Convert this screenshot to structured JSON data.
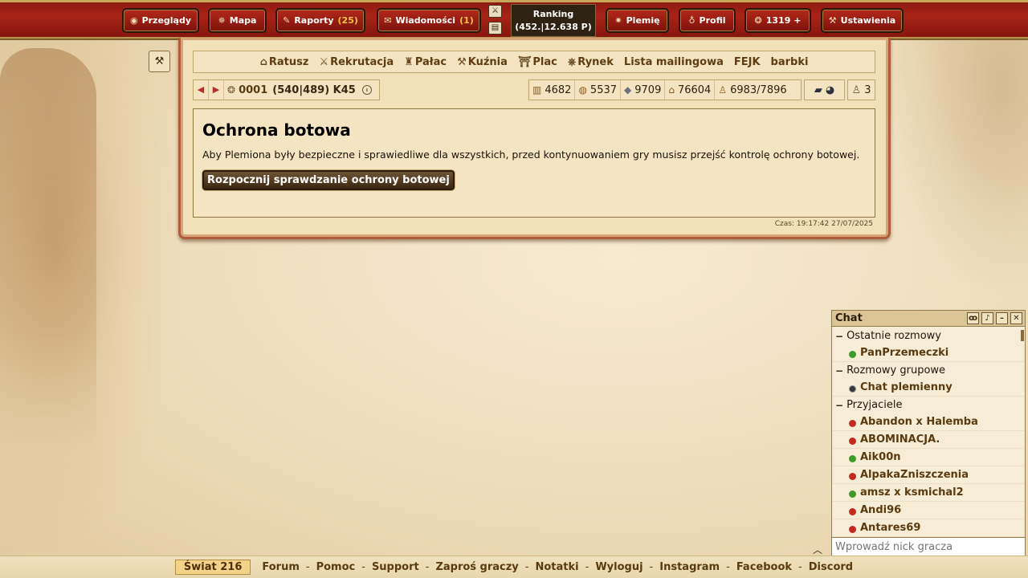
{
  "topbar": {
    "buttons": [
      {
        "label": "Przeglądy",
        "icon": "eye-icon"
      },
      {
        "label": "Mapa",
        "icon": "compass-icon"
      },
      {
        "label": "Raporty",
        "count": "(25)",
        "icon": "quill-icon"
      },
      {
        "label": "Wiadomości",
        "count": "(1)",
        "icon": "envelope-icon"
      },
      {
        "label": "Plemię",
        "icon": "tribe-icon"
      },
      {
        "label": "Profil",
        "icon": "potion-icon"
      },
      {
        "label": "1319 +",
        "icon": "premium-coin-icon"
      },
      {
        "label": "Ustawienia",
        "icon": "settings-icon"
      }
    ],
    "ranking_title": "Ranking",
    "ranking_value": "(452.|12.638 P)"
  },
  "menu": {
    "items": [
      {
        "label": "Ratusz",
        "icon": "town-hall-icon"
      },
      {
        "label": "Rekrutacja",
        "icon": "swords-icon"
      },
      {
        "label": "Pałac",
        "icon": "palace-icon"
      },
      {
        "label": "Kuźnia",
        "icon": "anvil-icon"
      },
      {
        "label": "Plac",
        "icon": "rally-point-icon"
      },
      {
        "label": "Rynek",
        "icon": "market-wheel-icon"
      },
      {
        "label": "Lista mailingowa"
      },
      {
        "label": "FEJK"
      },
      {
        "label": "barbki"
      }
    ]
  },
  "village": {
    "name": "0001",
    "coords": "(540|489) K45"
  },
  "resources": {
    "wood": "4682",
    "clay": "5537",
    "iron": "9709",
    "storage": "76604",
    "population": "6983/7896",
    "units": "3"
  },
  "content": {
    "title": "Ochrona botowa",
    "description": "Aby Plemiona były bezpieczne i sprawiedliwe dla wszystkich, przed kontynuowaniem gry musisz przejść kontrolę ochrony botowej.",
    "button": "Rozpocznij sprawdzanie ochrony botowej",
    "server_time": "Czas: 19:17:42 27/07/2025"
  },
  "chat": {
    "title": "Chat",
    "input_placeholder": "Wprowadź nick gracza",
    "groups": [
      {
        "label": "Ostatnie rozmowy",
        "items": [
          {
            "name": "PanPrzemeczki",
            "status": "online"
          }
        ]
      },
      {
        "label": "Rozmowy grupowe",
        "items": [
          {
            "name": "Chat plemienny",
            "status": "group"
          }
        ]
      },
      {
        "label": "Przyjaciele",
        "items": [
          {
            "name": "Abandon x Halemba",
            "status": "offline"
          },
          {
            "name": "ABOMINACJA.",
            "status": "offline"
          },
          {
            "name": "Aik00n",
            "status": "online"
          },
          {
            "name": "AlpakaZniszczenia",
            "status": "offline"
          },
          {
            "name": "amsz x ksmichal2",
            "status": "online"
          },
          {
            "name": "Andi96",
            "status": "offline"
          },
          {
            "name": "Antares69",
            "status": "offline"
          }
        ]
      }
    ]
  },
  "footer": {
    "world": "Świat 216",
    "links": [
      "Forum",
      "Pomoc",
      "Support",
      "Zaproś graczy",
      "Notatki",
      "Wyloguj",
      "Instagram",
      "Facebook",
      "Discord"
    ]
  }
}
